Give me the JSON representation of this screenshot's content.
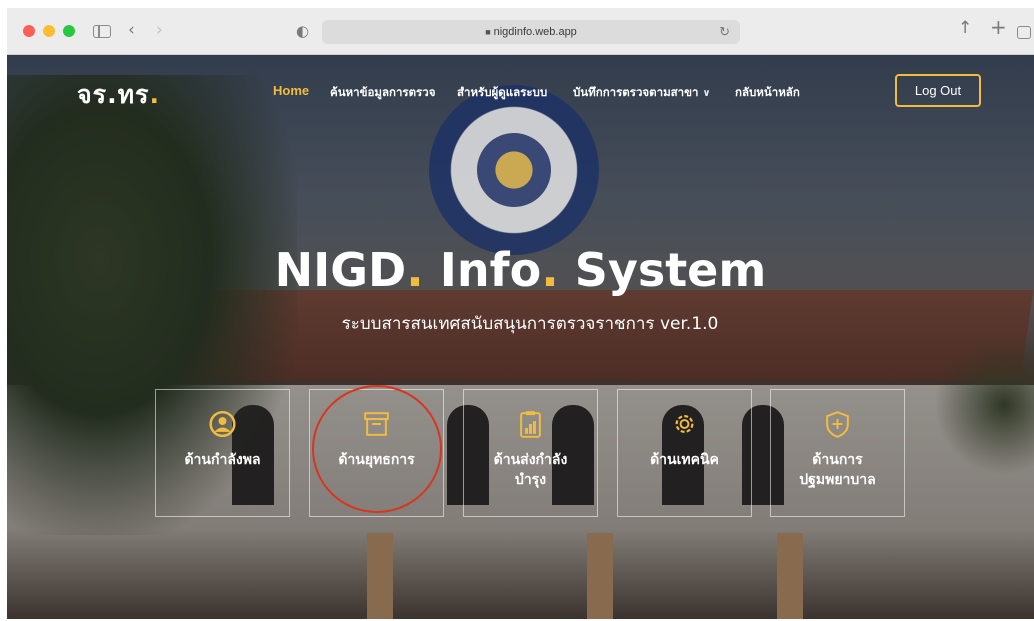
{
  "browser": {
    "url": "nigdinfo.web.app"
  },
  "nav": {
    "brand_main": "จร.ทร",
    "brand_dot": ".",
    "links": [
      {
        "label": "Home"
      },
      {
        "label": "ค้นหาข้อมูลการตรวจ"
      },
      {
        "label": "สำหรับผู้ดูแลระบบ"
      },
      {
        "label": "บันทึกการตรวจตามสาขา"
      },
      {
        "label": "กลับหน้าหลัก"
      }
    ],
    "logout_label": "Log Out"
  },
  "hero": {
    "title_part1": "NIGD",
    "title_dot1": ".",
    "title_part2": " Info",
    "title_dot2": ".",
    "title_part3": " System",
    "subtitle": "ระบบสารสนเทศสนับสนุนการตรวจราชการ ver.1.0"
  },
  "boxes": [
    {
      "line1": "ด้านกำลังพล",
      "line2": "",
      "icon": "user-circle-icon"
    },
    {
      "line1": "ด้านยุทธการ",
      "line2": "",
      "icon": "archive-box-icon"
    },
    {
      "line1": "ด้านส่งกำลัง",
      "line2": "บำรุง",
      "icon": "clipboard-chart-icon"
    },
    {
      "line1": "ด้านเทคนิค",
      "line2": "",
      "icon": "gear-icon"
    },
    {
      "line1": "ด้านการ",
      "line2": "ปฐมพยาบาล",
      "icon": "shield-plus-icon"
    }
  ],
  "colors": {
    "accent": "#f2bd3e",
    "highlight": "#d9351e"
  }
}
